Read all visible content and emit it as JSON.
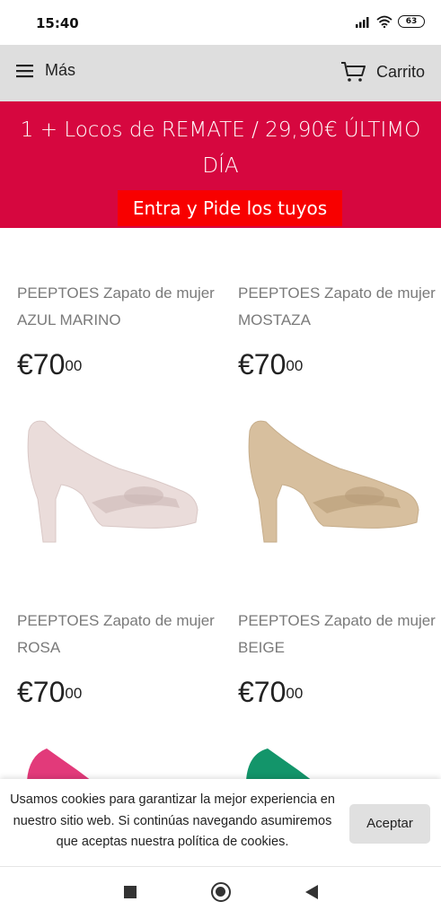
{
  "status_bar": {
    "time": "15:40",
    "battery": "63",
    "icons": [
      "signal-icon",
      "wifi-icon",
      "battery-icon"
    ]
  },
  "topnav": {
    "menu_label": "Más",
    "cart_label": "Carrito",
    "icons": [
      "hamburger-menu-icon",
      "shopping-cart-icon"
    ]
  },
  "promo": {
    "text": "1 + Locos de REMATE / 29,90€ ÚLTIMO DÍA",
    "button_label": "Entra y Pide los tuyos",
    "background": "#d6073f",
    "button_color": "#f80000"
  },
  "products": [
    {
      "title": "PEEPTOES Zapato de mujer AZUL MARINO",
      "price_main": "€70",
      "price_cents": "00"
    },
    {
      "title": "PEEPTOES Zapato de mujer MOSTAZA",
      "price_main": "€70",
      "price_cents": "00"
    },
    {
      "title": "PEEPTOES Zapato de mujer ROSA",
      "price_main": "€70",
      "price_cents": "00",
      "color": "#eadcda"
    },
    {
      "title": "PEEPTOES Zapato de mujer BEIGE",
      "price_main": "€70",
      "price_cents": "00",
      "color": "#d7bf9e"
    }
  ],
  "partial_products": [
    {
      "color": "#e23a7a"
    },
    {
      "color": "#13956a"
    }
  ],
  "cookie": {
    "text": "Usamos cookies para garantizar la mejor experiencia en nuestro sitio web. Si continúas navegando asumiremos que aceptas nuestra política de cookies.",
    "accept_label": "Aceptar"
  },
  "android_nav": {
    "icons": [
      "recents-icon",
      "home-icon",
      "back-icon"
    ]
  }
}
